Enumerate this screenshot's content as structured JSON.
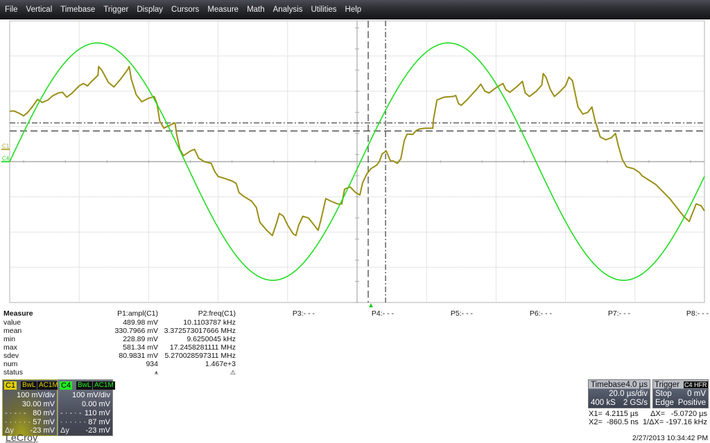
{
  "menubar": {
    "items": [
      "File",
      "Vertical",
      "Timebase",
      "Trigger",
      "Display",
      "Cursors",
      "Measure",
      "Math",
      "Analysis",
      "Utilities",
      "Help"
    ]
  },
  "colors": {
    "c1_trace": "#9a8f16",
    "c4_trace": "#22dd22",
    "grid": "#c8c8c8",
    "cursor": "#555555",
    "trigger_marker": "#22cc22"
  },
  "scope": {
    "h_divisions": 10,
    "v_divisions": 8,
    "channel_markers": [
      {
        "label": "C1",
        "color": "#b0a830",
        "level_div": 0.35
      },
      {
        "label": "C4",
        "color": "#22dd22",
        "level_div": 0.0
      }
    ],
    "cursors": {
      "x1_div": 5.16,
      "x2_div": 5.41,
      "y1_div": 1.1,
      "y2_div": 0.87
    },
    "trigger_position_div": 5.2,
    "c4_trace": {
      "type": "sine",
      "amplitude_div": 3.37,
      "period_div": 5.05,
      "phase_zero_div": 0.0,
      "offset_div": 0.0
    },
    "c1_trace": [
      [
        0.0,
        1.43
      ],
      [
        0.06,
        1.44
      ],
      [
        0.14,
        1.37
      ],
      [
        0.2,
        1.3
      ],
      [
        0.26,
        1.4
      ],
      [
        0.33,
        1.57
      ],
      [
        0.4,
        1.77
      ],
      [
        0.47,
        1.68
      ],
      [
        0.55,
        1.75
      ],
      [
        0.62,
        1.87
      ],
      [
        0.7,
        1.95
      ],
      [
        0.76,
        1.97
      ],
      [
        0.82,
        1.83
      ],
      [
        0.9,
        1.95
      ],
      [
        1.0,
        2.15
      ],
      [
        1.06,
        2.22
      ],
      [
        1.12,
        2.15
      ],
      [
        1.18,
        2.28
      ],
      [
        1.27,
        2.45
      ],
      [
        1.28,
        2.7
      ],
      [
        1.33,
        2.58
      ],
      [
        1.42,
        2.25
      ],
      [
        1.5,
        2.12
      ],
      [
        1.6,
        2.35
      ],
      [
        1.7,
        2.62
      ],
      [
        1.72,
        2.7
      ],
      [
        1.75,
        2.35
      ],
      [
        1.82,
        1.9
      ],
      [
        1.9,
        1.7
      ],
      [
        2.0,
        1.8
      ],
      [
        2.08,
        1.85
      ],
      [
        2.12,
        1.65
      ],
      [
        2.16,
        1.15
      ],
      [
        2.22,
        0.95
      ],
      [
        2.32,
        1.05
      ],
      [
        2.38,
        1.1
      ],
      [
        2.4,
        0.8
      ],
      [
        2.45,
        0.35
      ],
      [
        2.5,
        0.17
      ],
      [
        2.6,
        0.3
      ],
      [
        2.66,
        0.35
      ],
      [
        2.72,
        0.1
      ],
      [
        2.8,
        0.0
      ],
      [
        2.9,
        -0.05
      ],
      [
        2.95,
        -0.28
      ],
      [
        3.0,
        -0.42
      ],
      [
        3.1,
        -0.48
      ],
      [
        3.2,
        -0.55
      ],
      [
        3.26,
        -0.62
      ],
      [
        3.3,
        -0.88
      ],
      [
        3.38,
        -1.0
      ],
      [
        3.48,
        -1.12
      ],
      [
        3.55,
        -1.3
      ],
      [
        3.6,
        -1.72
      ],
      [
        3.7,
        -1.95
      ],
      [
        3.78,
        -2.1
      ],
      [
        3.84,
        -1.75
      ],
      [
        3.88,
        -1.47
      ],
      [
        3.94,
        -1.55
      ],
      [
        4.0,
        -1.8
      ],
      [
        4.08,
        -2.05
      ],
      [
        4.12,
        -2.1
      ],
      [
        4.16,
        -1.8
      ],
      [
        4.22,
        -1.55
      ],
      [
        4.3,
        -1.6
      ],
      [
        4.4,
        -1.85
      ],
      [
        4.44,
        -1.95
      ],
      [
        4.48,
        -1.65
      ],
      [
        4.55,
        -1.05
      ],
      [
        4.62,
        -1.12
      ],
      [
        4.72,
        -1.2
      ],
      [
        4.78,
        -1.2
      ],
      [
        4.82,
        -0.78
      ],
      [
        4.9,
        -0.72
      ],
      [
        4.98,
        -0.88
      ],
      [
        5.04,
        -0.95
      ],
      [
        5.08,
        -0.6
      ],
      [
        5.14,
        -0.35
      ],
      [
        5.2,
        -0.2
      ],
      [
        5.28,
        -0.1
      ],
      [
        5.32,
        0.0
      ],
      [
        5.36,
        0.22
      ],
      [
        5.42,
        0.3
      ],
      [
        5.48,
        0.02
      ],
      [
        5.52,
        0.02
      ],
      [
        5.58,
        -0.05
      ],
      [
        5.63,
        0.08
      ],
      [
        5.68,
        0.6
      ],
      [
        5.72,
        0.78
      ],
      [
        5.8,
        0.77
      ],
      [
        5.85,
        0.88
      ],
      [
        5.9,
        0.93
      ],
      [
        5.98,
        0.95
      ],
      [
        6.05,
        0.95
      ],
      [
        6.09,
        0.95
      ],
      [
        6.1,
        1.2
      ],
      [
        6.15,
        1.75
      ],
      [
        6.25,
        1.83
      ],
      [
        6.38,
        1.85
      ],
      [
        6.42,
        1.88
      ],
      [
        6.46,
        1.65
      ],
      [
        6.5,
        1.6
      ],
      [
        6.58,
        1.75
      ],
      [
        6.72,
        2.05
      ],
      [
        6.78,
        2.2
      ],
      [
        6.84,
        2.0
      ],
      [
        6.9,
        1.95
      ],
      [
        7.0,
        2.1
      ],
      [
        7.1,
        2.22
      ],
      [
        7.14,
        2.05
      ],
      [
        7.2,
        1.97
      ],
      [
        7.3,
        2.13
      ],
      [
        7.38,
        2.28
      ],
      [
        7.42,
        1.95
      ],
      [
        7.48,
        1.85
      ],
      [
        7.58,
        2.0
      ],
      [
        7.66,
        2.18
      ],
      [
        7.68,
        2.5
      ],
      [
        7.72,
        2.4
      ],
      [
        7.78,
        2.05
      ],
      [
        7.84,
        1.85
      ],
      [
        7.9,
        1.95
      ],
      [
        8.0,
        2.15
      ],
      [
        8.05,
        2.4
      ],
      [
        8.1,
        2.3
      ],
      [
        8.18,
        1.55
      ],
      [
        8.25,
        1.35
      ],
      [
        8.32,
        1.4
      ],
      [
        8.38,
        1.55
      ],
      [
        8.42,
        1.2
      ],
      [
        8.5,
        0.7
      ],
      [
        8.58,
        0.62
      ],
      [
        8.66,
        0.68
      ],
      [
        8.72,
        0.8
      ],
      [
        8.76,
        0.45
      ],
      [
        8.82,
        0.05
      ],
      [
        8.88,
        -0.15
      ],
      [
        8.98,
        -0.2
      ],
      [
        9.06,
        -0.3
      ],
      [
        9.1,
        -0.4
      ],
      [
        9.18,
        -0.5
      ],
      [
        9.3,
        -0.65
      ],
      [
        9.4,
        -0.85
      ],
      [
        9.5,
        -1.05
      ],
      [
        9.6,
        -1.3
      ],
      [
        9.7,
        -1.55
      ],
      [
        9.78,
        -1.7
      ],
      [
        9.83,
        -1.45
      ],
      [
        9.88,
        -1.2
      ],
      [
        9.95,
        -1.25
      ],
      [
        10.0,
        -1.4
      ]
    ]
  },
  "measure": {
    "title": "Measure",
    "row_labels": [
      "value",
      "mean",
      "min",
      "max",
      "sdev",
      "num",
      "status"
    ],
    "params": [
      {
        "header": "P1:ampl(C1)",
        "values": [
          "489.98 mV",
          "330.7966 mV",
          "228.89 mV",
          "581.34 mV",
          "80.9831 mV",
          "934",
          "⩚"
        ]
      },
      {
        "header": "P2:freq(C1)",
        "values": [
          "10.1103787 kHz",
          "3.372573017666 MHz",
          "9.6250045 kHz",
          "17.2458281111 MHz",
          "5.270028597311 MHz",
          "1.467e+3",
          "⚠"
        ]
      },
      {
        "header": "P3:- - -"
      },
      {
        "header": "P4:- - -"
      },
      {
        "header": "P5:- - -"
      },
      {
        "header": "P6:- - -"
      },
      {
        "header": "P7:- - -"
      },
      {
        "header": "P8:- - -"
      }
    ]
  },
  "channels": [
    {
      "name": "C1",
      "tag_color": "#e0d000",
      "bw": "BwL",
      "coupling": "AC1M",
      "scale": "100 mV/div",
      "offset": "30.00 mV",
      "cursor1": "80 mV",
      "cursor2": "57 mV",
      "delta_label": "Δy",
      "delta": "-23 mV"
    },
    {
      "name": "C4",
      "tag_color": "#22ee22",
      "bw": "BwL",
      "coupling": "AC1M",
      "scale": "100 mV/div",
      "offset": "0.00 mV",
      "cursor1": "110 mV",
      "cursor2": "87 mV",
      "delta_label": "Δy",
      "delta": "-23 mV"
    }
  ],
  "logo": "LeCroy",
  "timebase": {
    "label": "Timebase",
    "delay": "4.0 µs",
    "scale": "20.0 µs/div",
    "samples": "400 kS",
    "rate": "2 GS/s"
  },
  "trigger": {
    "label": "Trigger",
    "source": "C4",
    "coupling": "HFR",
    "mode": "Stop",
    "level": "0 mV",
    "type": "Edge",
    "slope": "Positive"
  },
  "cursor_readout": {
    "x1_label": "X1=",
    "x1": "4.2115 µs",
    "x2_label": "X2=",
    "x2": "-860.5 ns",
    "dx_label": "ΔX=",
    "dx": "-5.0720 µs",
    "inv_dx_label": "1/ΔX=",
    "inv_dx": "-197.16 kHz"
  },
  "datetime": "2/27/2013 10:34:42 PM"
}
